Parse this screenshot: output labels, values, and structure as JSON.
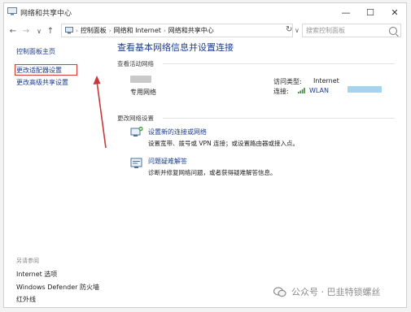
{
  "window": {
    "title": "网络和共享中心",
    "minimize_glyph": "—",
    "maximize_glyph": "☐",
    "close_glyph": "✕"
  },
  "address": {
    "back_glyph": "←",
    "forward_glyph": "→",
    "up_glyph": "↑",
    "segments": [
      "控制面板",
      "网络和 Internet",
      "网络和共享中心"
    ],
    "refresh_glyph": "↻",
    "dropdown_glyph": "∨",
    "search_placeholder": "搜索控制面板"
  },
  "sidebar": {
    "home_label": "控制面板主页",
    "adapter_label": "更改适配器设置",
    "advanced_label": "更改高级共享设置",
    "see_also_label": "另请参阅",
    "see_also": [
      "Internet 选项",
      "Windows Defender 防火墙",
      "红外线"
    ]
  },
  "main": {
    "heading": "查看基本网络信息并设置连接",
    "active_networks_label": "查看活动网络",
    "network_type": "专用网络",
    "access_type_label": "访问类型:",
    "access_type_value": "Internet",
    "connection_label": "连接:",
    "connection_value": "WLAN",
    "change_settings_label": "更改网络设置",
    "tasks": [
      {
        "title": "设置新的连接或网络",
        "desc": "设置宽带、拨号或 VPN 连接；或设置路由器或接入点。"
      },
      {
        "title": "问题疑难解答",
        "desc": "诊断并修复网络问题，或者获得疑难解答信息。"
      }
    ]
  },
  "watermark": {
    "text": "公众号 · 巴韭特锁螺丝"
  },
  "colors": {
    "link": "#1a3d8f",
    "annotation": "#d63a3a"
  }
}
